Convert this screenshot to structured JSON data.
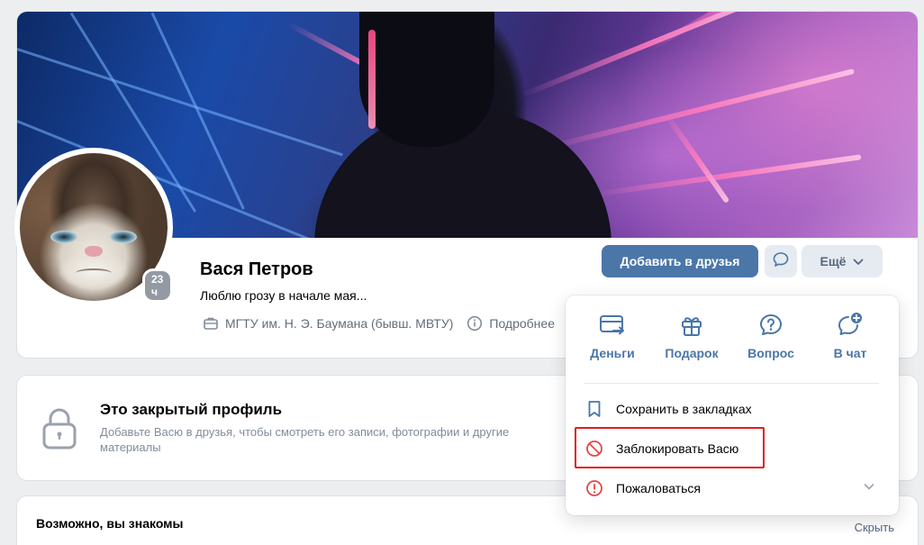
{
  "profile": {
    "name": "Вася Петров",
    "status": "Люблю грозу в начале мая...",
    "online_badge": "23 ч",
    "education": "МГТУ им. Н. Э. Баумана (бывш. МВТУ)",
    "more_info": "Подробнее"
  },
  "buttons": {
    "add_friend": "Добавить в друзья",
    "more": "Ещё"
  },
  "closed_profile": {
    "title": "Это закрытый профиль",
    "description": "Добавьте Васю в друзья, чтобы смотреть его записи, фотографии и другие материалы"
  },
  "friends_suggest": {
    "title": "Возможно, вы знакомы",
    "hide": "Скрыть"
  },
  "dropdown": {
    "actions": [
      {
        "label": "Деньги",
        "icon": "money-transfer-icon"
      },
      {
        "label": "Подарок",
        "icon": "gift-icon"
      },
      {
        "label": "Вопрос",
        "icon": "question-icon"
      },
      {
        "label": "В чат",
        "icon": "add-chat-icon"
      }
    ],
    "items": [
      {
        "label": "Сохранить в закладках",
        "icon": "bookmark-icon"
      },
      {
        "label": "Заблокировать Васю",
        "icon": "block-icon",
        "highlighted": true
      },
      {
        "label": "Пожаловаться",
        "icon": "report-icon",
        "has_submenu": true
      }
    ]
  },
  "colors": {
    "accent": "#4a76a8",
    "danger": "#e64646",
    "highlight_border": "#e11b1b",
    "secondary_text": "#626d7a",
    "page_bg": "#edeef0"
  }
}
